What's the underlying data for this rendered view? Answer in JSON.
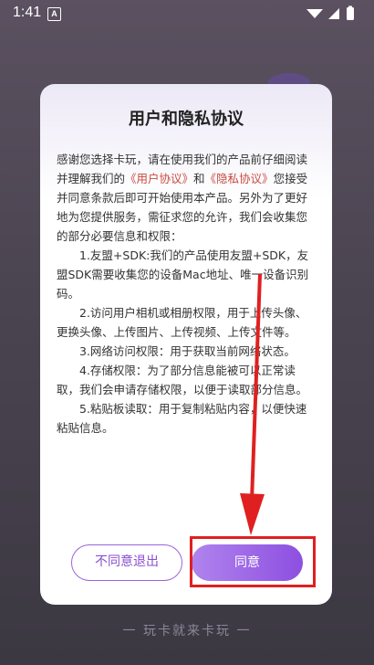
{
  "status_bar": {
    "time": "1:41",
    "notification_letter": "A"
  },
  "dialog": {
    "title": "用户和隐私协议",
    "intro_pre": "感谢您选择卡玩，请在使用我们的产品前仔细阅读并理解我们的",
    "user_agreement_link": "《用户协议》",
    "and_text": "和",
    "privacy_link": "《隐私协议》",
    "intro_post": "您接受并同意条款后即可开始使用本产品。另外为了更好地为您提供服务，需征求您的允许，我们会收集您的部分必要信息和权限：",
    "items": [
      "1.友盟+SDK:我们的产品使用友盟+SDK，友盟SDK需要收集您的设备Mac地址、唯一设备识别码。",
      "2.访问用户相机或相册权限，用于上传头像、更换头像、上传图片、上传视频、上传文件等。",
      "3.网络访问权限：用于获取当前网络状态。",
      "4.存储权限：为了部分信息能被可以正常读取，我们会申请存储权限，以便于读取部分信息。",
      "5.粘贴板读取：用于复制粘贴内容，以便快速粘贴信息。"
    ],
    "decline_label": "不同意退出",
    "agree_label": "同意"
  },
  "footer": {
    "slogan": "一 玩卡就来卡玩 一"
  },
  "colors": {
    "accent": "#8d4fe0",
    "link": "#c94b3f",
    "annotation": "#e02020"
  }
}
